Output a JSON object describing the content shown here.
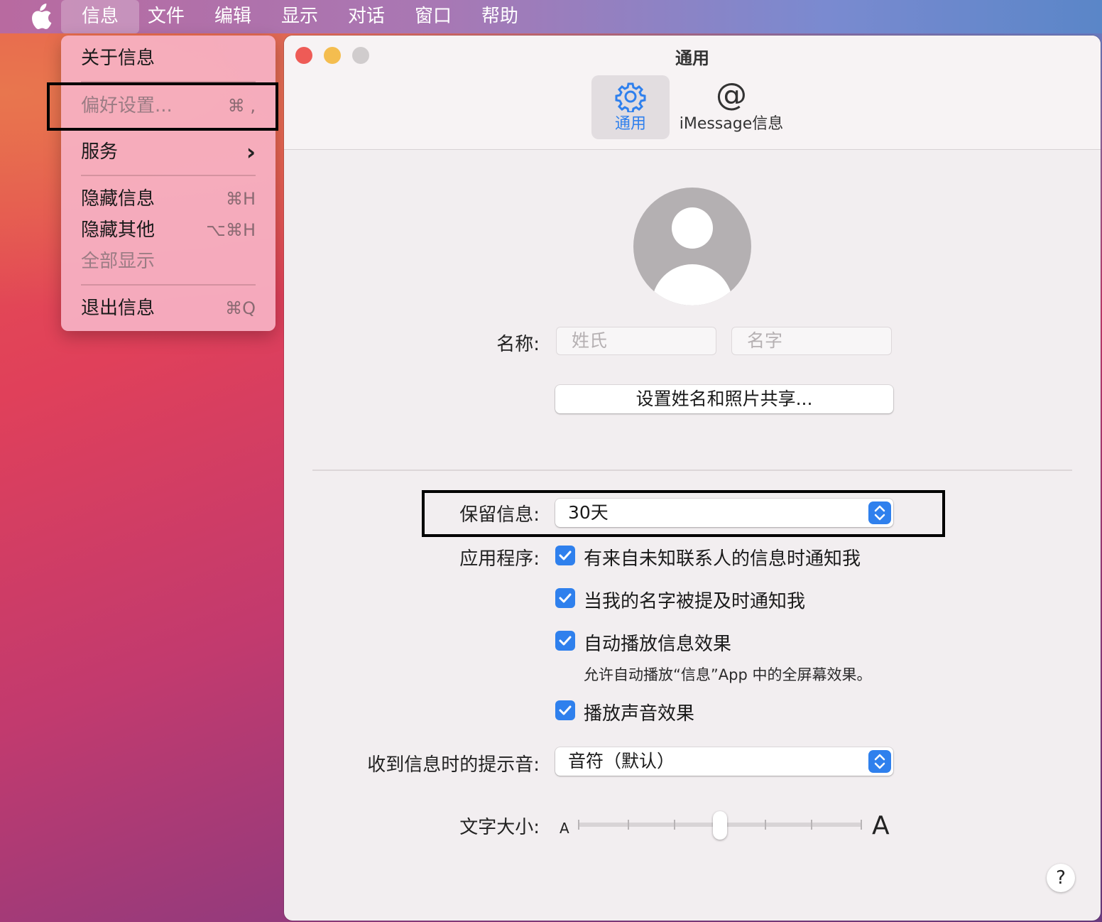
{
  "menubar": {
    "apple_icon": "apple-logo",
    "items": [
      "信息",
      "文件",
      "编辑",
      "显示",
      "对话",
      "窗口",
      "帮助"
    ],
    "active_index": 0
  },
  "dropdown": {
    "about": "关于信息",
    "preferences": "偏好设置...",
    "preferences_shortcut": "⌘ ,",
    "services": "服务",
    "services_arrow": "›",
    "hide": "隐藏信息",
    "hide_shortcut": "⌘H",
    "hide_others": "隐藏其他",
    "hide_others_shortcut": "⌥⌘H",
    "show_all": "全部显示",
    "quit": "退出信息",
    "quit_shortcut": "⌘Q"
  },
  "window": {
    "title": "通用",
    "traffic_lights": {
      "close": "#ee5b56",
      "minimize": "#f4bd4f",
      "zoom": "#d0cccd"
    },
    "tabs": [
      {
        "label": "通用",
        "icon": "gear-icon",
        "selected": true
      },
      {
        "label": "iMessage信息",
        "icon": "at-icon",
        "selected": false
      }
    ],
    "name_label": "名称:",
    "last_name_placeholder": "姓氏",
    "first_name_placeholder": "名字",
    "share_button": "设置姓名和照片共享...",
    "keep_label": "保留信息:",
    "keep_value": "30天",
    "app_label": "应用程序:",
    "checkboxes": [
      {
        "label": "有来自未知联系人的信息时通知我",
        "checked": true
      },
      {
        "label": "当我的名字被提及时通知我",
        "checked": true
      },
      {
        "label": "自动播放信息效果",
        "checked": true
      },
      {
        "label": "播放声音效果",
        "checked": true
      }
    ],
    "autoplay_hint": "允许自动播放“信息”App 中的全屏幕效果。",
    "sound_label": "收到信息时的提示音:",
    "sound_value": "音符（默认）",
    "text_size_label": "文字大小:",
    "text_size_small": "A",
    "text_size_large": "A",
    "text_size_level": 0.5,
    "help": "?"
  },
  "colors": {
    "accent": "#2f80ed"
  }
}
